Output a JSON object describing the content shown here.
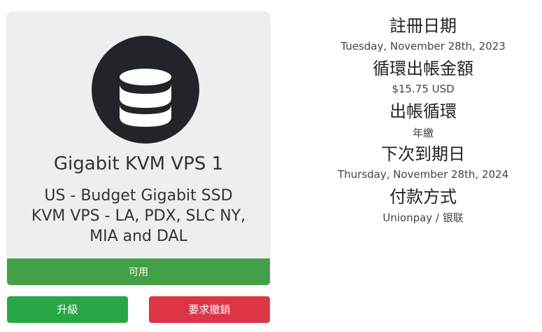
{
  "product": {
    "icon": "database-icon",
    "name": "Gigabit KVM VPS 1",
    "description": "US - Budget Gigabit SSD KVM VPS - LA, PDX, SLC NY, MIA and DAL",
    "status": "可用"
  },
  "actions": {
    "upgrade_label": "升級",
    "cancel_label": "要求撤銷"
  },
  "details": {
    "registration_label": "註冊日期",
    "registration_date": "Tuesday, November 28th, 2023",
    "recurring_amount_label": "循環出帳金額",
    "recurring_amount": "$15.75 USD",
    "billing_cycle_label": "出帳循環",
    "billing_cycle": "年繳",
    "next_due_label": "下次到期日",
    "next_due_date": "Thursday, November 28th, 2024",
    "payment_method_label": "付款方式",
    "payment_method": "Unionpay / 银联"
  },
  "colors": {
    "status_active": "#43a047",
    "upgrade_button": "#28a745",
    "cancel_button": "#dc3545",
    "icon_circle": "#212529"
  }
}
